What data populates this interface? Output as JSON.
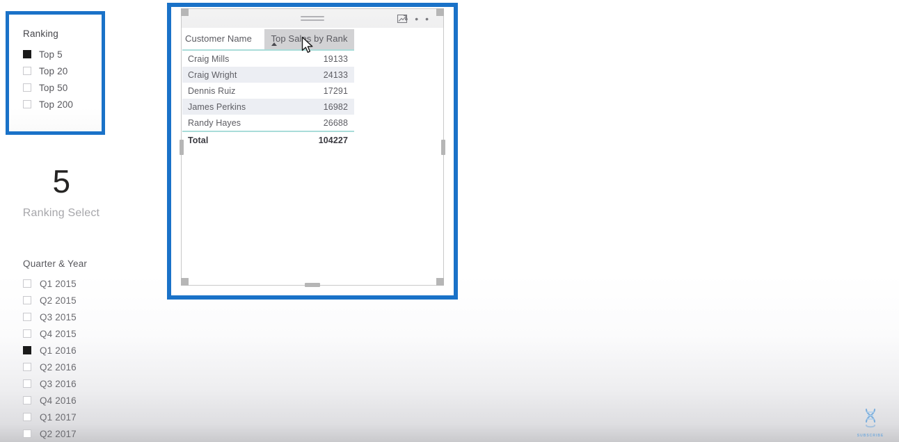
{
  "ranking_slicer": {
    "title": "Ranking",
    "items": [
      {
        "label": "Top 5",
        "checked": true
      },
      {
        "label": "Top 20",
        "checked": false
      },
      {
        "label": "Top 50",
        "checked": false
      },
      {
        "label": "Top 200",
        "checked": false
      }
    ]
  },
  "ranking_card": {
    "value": "5",
    "label": "Ranking Select"
  },
  "quarter_slicer": {
    "title": "Quarter & Year",
    "items": [
      {
        "label": "Q1 2015",
        "checked": false
      },
      {
        "label": "Q2 2015",
        "checked": false
      },
      {
        "label": "Q3 2015",
        "checked": false
      },
      {
        "label": "Q4 2015",
        "checked": false
      },
      {
        "label": "Q1 2016",
        "checked": true
      },
      {
        "label": "Q2 2016",
        "checked": false
      },
      {
        "label": "Q3 2016",
        "checked": false
      },
      {
        "label": "Q4 2016",
        "checked": false
      },
      {
        "label": "Q1 2017",
        "checked": false
      },
      {
        "label": "Q2 2017",
        "checked": false
      }
    ]
  },
  "table_visual": {
    "header_icons": {
      "drag_handle": "drag-handle-icon",
      "focus_mode": "focus-mode-icon",
      "more_options": "• • •"
    },
    "columns": [
      {
        "key": "name",
        "label": "Customer Name",
        "align": "left",
        "sorted": false
      },
      {
        "key": "value",
        "label": "Top Sales by Rank",
        "align": "right",
        "sorted": true,
        "sort_direction": "ascending"
      }
    ],
    "rows": [
      {
        "name": "Craig Mills",
        "value": "19133"
      },
      {
        "name": "Craig Wright",
        "value": "24133"
      },
      {
        "name": "Dennis Ruiz",
        "value": "17291"
      },
      {
        "name": "James Perkins",
        "value": "16982"
      },
      {
        "name": "Randy Hayes",
        "value": "26688"
      }
    ],
    "total": {
      "name": "Total",
      "value": "104227"
    }
  },
  "watermark": {
    "label": "SUBSCRIBE",
    "icon": "dna-helix-icon"
  },
  "colors": {
    "highlight_blue": "#1a72c8",
    "teal_rule": "#a9dcd9",
    "row_alt": "#eceef3",
    "header_hover": "#d2d2d4",
    "checkbox_checked": "#1a1a1a"
  }
}
